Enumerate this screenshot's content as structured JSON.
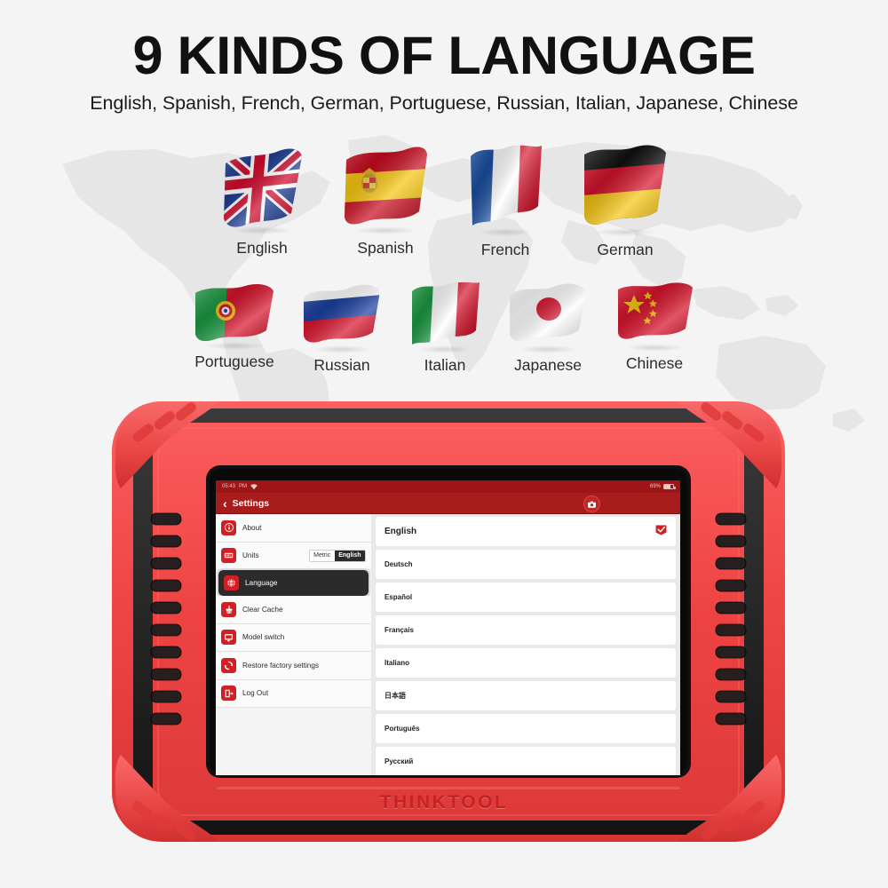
{
  "headline": "9 KINDS OF LANGUAGE",
  "subhead": "English, Spanish, French, German, Portuguese, Russian, Italian, Japanese, Chinese",
  "flags_row1": [
    {
      "label": "English",
      "icon": "flag-uk-icon"
    },
    {
      "label": "Spanish",
      "icon": "flag-spain-icon"
    },
    {
      "label": "French",
      "icon": "flag-france-icon"
    },
    {
      "label": "German",
      "icon": "flag-germany-icon"
    }
  ],
  "flags_row2": [
    {
      "label": "Portuguese",
      "icon": "flag-portugal-icon"
    },
    {
      "label": "Russian",
      "icon": "flag-russia-icon"
    },
    {
      "label": "Italian",
      "icon": "flag-italy-icon"
    },
    {
      "label": "Japanese",
      "icon": "flag-japan-icon"
    },
    {
      "label": "Chinese",
      "icon": "flag-china-icon"
    }
  ],
  "device": {
    "brand": "THINKTOOL",
    "brand_color": "#c62222",
    "shell_color": "#ef4a4a",
    "inner_color": "#2a2a2a"
  },
  "screen": {
    "statusbar": {
      "time": "05:43",
      "meridiem": "PM",
      "wifi_icon": "wifi-icon",
      "battery_percent": "69%",
      "battery_icon": "battery-icon"
    },
    "topbar": {
      "back_icon": "back-chevron-icon",
      "title": "Settings",
      "camera_icon": "camera-icon",
      "accent": "#a81c1c"
    },
    "sidebar": {
      "items": [
        {
          "label": "About",
          "icon": "info-icon",
          "active": false
        },
        {
          "label": "Units",
          "icon": "gauge-icon",
          "active": false
        },
        {
          "label": "Language",
          "icon": "globe-icon",
          "active": true
        },
        {
          "label": "Clear Cache",
          "icon": "broom-icon",
          "active": false
        },
        {
          "label": "Model switch",
          "icon": "monitor-icon",
          "active": false
        },
        {
          "label": "Restore factory settings",
          "icon": "refresh-icon",
          "active": false
        },
        {
          "label": "Log Out",
          "icon": "logout-icon",
          "active": false
        }
      ],
      "units_toggle": {
        "options": [
          "Metric",
          "English"
        ],
        "selected": "English"
      }
    },
    "languages": [
      {
        "name": "English",
        "selected": true
      },
      {
        "name": "Deutsch",
        "selected": false
      },
      {
        "name": "Español",
        "selected": false
      },
      {
        "name": "Français",
        "selected": false
      },
      {
        "name": "Italiano",
        "selected": false
      },
      {
        "name": "日本語",
        "selected": false
      },
      {
        "name": "Português",
        "selected": false
      },
      {
        "name": "Русский",
        "selected": false
      }
    ],
    "check_icon": "checkbox-checked-icon",
    "check_color": "#d11f26"
  }
}
